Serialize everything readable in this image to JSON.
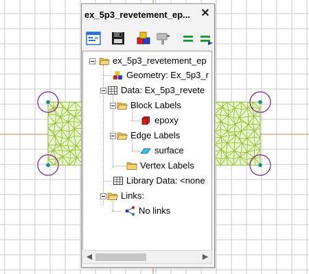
{
  "window": {
    "title": "ex_5p3_revetement_ep...",
    "close_label": "✕"
  },
  "toolbar": {
    "buttons": [
      "properties-icon",
      "save-icon",
      "materials-icon",
      "tools-icon",
      "equal-icon",
      "equal-arrow-icon"
    ]
  },
  "tree": {
    "root": "ex_5p3_revetement_ep",
    "geometry": "Geometry: Ex_5p3_r",
    "data": "Data: Ex_5p3_revete",
    "block_labels": "Block Labels",
    "epoxy": "epoxy",
    "edge_labels": "Edge Labels",
    "surface": "surface",
    "vertex_labels": "Vertex Labels",
    "library_data": "Library Data: <none",
    "links": "Links:",
    "no_links": "No links"
  },
  "colors": {
    "mesh": "#8fbf2a",
    "vertex_circle": "#7a1a8a",
    "vertex_dot": "#138a8a",
    "grid": "#c8c8c8",
    "axis": "#b58a3a",
    "boundary": "#2d5fc9"
  }
}
